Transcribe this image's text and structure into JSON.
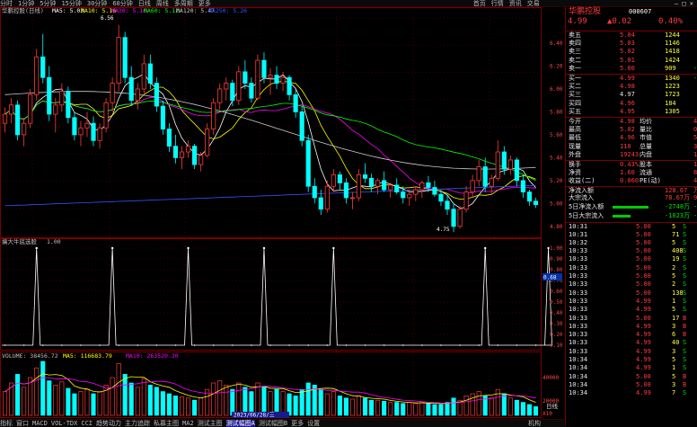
{
  "topbar": {
    "tabs": [
      "分时",
      "1分钟",
      "5分钟",
      "15分钟",
      "30分钟",
      "60分钟",
      "日线",
      "周线",
      "多周期",
      "更多"
    ],
    "right_tabs": [
      "首页",
      "行情",
      "资讯",
      "交易"
    ],
    "win_controls": "— □ ✕"
  },
  "stock": {
    "name": "华鹏控股",
    "code": "000607",
    "price": "4.99",
    "change": "▲0.02",
    "pct": "0.40%"
  },
  "main_legend": {
    "title": "华鹏控股(日线)",
    "ma5": "MA5: 5.03",
    "ma10": "MA10: 5.16",
    "ma20": "MA20: 5.16",
    "ma60": "MA60: 5.12",
    "ma120": "MA120: 5.47",
    "ma250": "MA250: 5.26"
  },
  "price_annotations": {
    "high": "6.56",
    "low": "4.75"
  },
  "colors": {
    "up": "#ff3b3b",
    "down": "#00ffff",
    "ma5": "#ffffff",
    "ma10": "#ffff00",
    "ma20": "#ff00ff",
    "ma60": "#00ff00",
    "ma120": "#cccccc",
    "ma250": "#3355ff"
  },
  "indicator": {
    "title": "擒大牛底选股",
    "value": "1.00",
    "current_marker": "0.68"
  },
  "volume": {
    "title": "VOLUME: 38456.72",
    "ma5": "MA5: 116683.79",
    "ma10": "MA10: 263520.20"
  },
  "date_label": "2023/06/28/三",
  "sell_book": [
    {
      "label": "卖五",
      "price": "5.04",
      "vol": "1244"
    },
    {
      "label": "卖四",
      "price": "5.03",
      "vol": "1146"
    },
    {
      "label": "卖三",
      "price": "5.02",
      "vol": "1418"
    },
    {
      "label": "卖二",
      "price": "5.01",
      "vol": "1424"
    },
    {
      "label": "卖一",
      "price": "5.00",
      "vol": "909",
      "extra": "-5"
    }
  ],
  "buy_book": [
    {
      "label": "买一",
      "price": "4.99",
      "vol": "1340",
      "extra": "-10"
    },
    {
      "label": "买二",
      "price": "4.98",
      "vol": "1223"
    },
    {
      "label": "买三",
      "price": "4.97",
      "vol": "1723"
    },
    {
      "label": "买四",
      "price": "4.96",
      "vol": "184"
    },
    {
      "label": "买五",
      "price": "4.95",
      "vol": "1305"
    }
  ],
  "stats": [
    {
      "l1": "今开",
      "v1": "4.98",
      "l2": "均价",
      "v2": "4.9"
    },
    {
      "l1": "最高",
      "v1": "5.02",
      "l2": "量比",
      "v2": "0.7"
    },
    {
      "l1": "最低",
      "v1": "4.96",
      "l2": "市值",
      "v2": "50.8"
    },
    {
      "l1": "现量",
      "v1": "110",
      "l2": "总量",
      "v2": "3845"
    },
    {
      "l1": "外盘",
      "v1": "19243",
      "l2": "内盘",
      "v2": "1921"
    },
    {
      "l1": "换手",
      "v1": "0.43%",
      "l2": "股本",
      "v2": "10.2"
    },
    {
      "l1": "净资",
      "v1": "1.60",
      "l2": "流通",
      "v2": "8.85"
    },
    {
      "l1": "收益(二)",
      "v1": "0.060",
      "l2": "PE(动)",
      "v2": "45."
    }
  ],
  "flows": [
    {
      "label": "净流入额",
      "value": "128.67",
      "extra": "万"
    },
    {
      "label": "大宗流入",
      "value": "78.67万",
      "extra": "95"
    },
    {
      "label": "5日净流入额",
      "value": "-2748万",
      "extra": "-5"
    },
    {
      "label": "5日大宗流入",
      "value": "-1023万",
      "extra": "-35"
    }
  ],
  "ticks": [
    {
      "t": "10:31",
      "p": "5.00",
      "v": "5",
      "d": "S"
    },
    {
      "t": "10:31",
      "p": "5.00",
      "v": "71",
      "d": "S"
    },
    {
      "t": "10:32",
      "p": "5.00",
      "v": "5",
      "d": "S"
    },
    {
      "t": "10:33",
      "p": "5.00",
      "v": "408",
      "d": "S"
    },
    {
      "t": "10:33",
      "p": "5.00",
      "v": "19",
      "d": "S"
    },
    {
      "t": "10:33",
      "p": "5.00",
      "v": "2",
      "d": "S"
    },
    {
      "t": "10:33",
      "p": "5.00",
      "v": "5",
      "d": "S"
    },
    {
      "t": "10:33",
      "p": "5.00",
      "v": "2",
      "d": "S"
    },
    {
      "t": "10:33",
      "p": "5.00",
      "v": "138",
      "d": "S"
    },
    {
      "t": "10:33",
      "p": "4.99",
      "v": "1",
      "d": "S"
    },
    {
      "t": "10:33",
      "p": "4.99",
      "v": "5",
      "d": "S"
    },
    {
      "t": "10:33",
      "p": "5.00",
      "v": "17",
      "d": "B"
    },
    {
      "t": "10:33",
      "p": "4.99",
      "v": "3",
      "d": "B"
    },
    {
      "t": "10:33",
      "p": "4.99",
      "v": "6",
      "d": "B"
    },
    {
      "t": "10:33",
      "p": "4.99",
      "v": "40",
      "d": "S"
    },
    {
      "t": "10:33",
      "p": "4.99",
      "v": "3",
      "d": "S"
    },
    {
      "t": "10:34",
      "p": "4.99",
      "v": "5",
      "d": "S"
    },
    {
      "t": "10:34",
      "p": "4.99",
      "v": "1",
      "d": "S"
    },
    {
      "t": "10:34",
      "p": "5.00",
      "v": "5",
      "d": "B"
    },
    {
      "t": "10:34",
      "p": "5.00",
      "v": "3",
      "d": "B"
    },
    {
      "t": "10:34",
      "p": "4.99",
      "v": "7",
      "d": "S"
    }
  ],
  "panel_tabs": [
    "日线",
    "..."
  ],
  "bottom_tabs": [
    "指标",
    "窗口",
    "MACD",
    "VOL-TDX",
    "CCI",
    "趋势动力",
    "主力追踪",
    "私募主图",
    "MA2",
    "测试主图",
    "测试幅图A",
    "测试幅图B",
    "更多",
    "设置"
  ],
  "bottom_right": "机构",
  "chart_data": {
    "type": "candlestick",
    "price_axis": [
      "6.40",
      "6.20",
      "6.00",
      "5.80",
      "5.60",
      "5.40",
      "5.20",
      "5.00",
      "4.80"
    ],
    "ylim": [
      4.72,
      6.62
    ],
    "indicator_axis": [
      "1.00",
      "0.90",
      "0.80",
      "0.70",
      "0.60",
      "0.50",
      "0.40",
      "0.30",
      "0.20",
      "0.10"
    ],
    "volume_axis": [
      "40000",
      "20000",
      "X10"
    ],
    "candles": [
      [
        5.7,
        5.84,
        5.62,
        5.78
      ],
      [
        5.78,
        5.92,
        5.7,
        5.86
      ],
      [
        5.86,
        5.9,
        5.55,
        5.6
      ],
      [
        5.6,
        5.75,
        5.5,
        5.7
      ],
      [
        5.7,
        6.0,
        5.66,
        5.95
      ],
      [
        5.95,
        6.35,
        5.9,
        6.28
      ],
      [
        6.28,
        6.48,
        6.05,
        6.1
      ],
      [
        6.1,
        6.2,
        5.72,
        5.78
      ],
      [
        5.78,
        5.92,
        5.62,
        5.86
      ],
      [
        5.86,
        6.05,
        5.8,
        5.98
      ],
      [
        5.98,
        6.02,
        5.7,
        5.75
      ],
      [
        5.75,
        5.8,
        5.55,
        5.6
      ],
      [
        5.6,
        5.72,
        5.5,
        5.66
      ],
      [
        5.66,
        5.8,
        5.58,
        5.7
      ],
      [
        5.7,
        5.76,
        5.5,
        5.55
      ],
      [
        5.55,
        5.7,
        5.48,
        5.66
      ],
      [
        5.66,
        5.92,
        5.62,
        5.88
      ],
      [
        5.88,
        6.1,
        5.8,
        6.05
      ],
      [
        6.05,
        6.56,
        5.98,
        6.45
      ],
      [
        6.45,
        6.5,
        6.05,
        6.1
      ],
      [
        6.1,
        6.2,
        5.85,
        5.9
      ],
      [
        5.9,
        6.05,
        5.82,
        6.0
      ],
      [
        6.0,
        6.3,
        5.95,
        6.22
      ],
      [
        6.22,
        6.3,
        6.0,
        6.05
      ],
      [
        6.05,
        6.1,
        5.8,
        5.85
      ],
      [
        5.85,
        5.9,
        5.6,
        5.65
      ],
      [
        5.65,
        5.7,
        5.45,
        5.5
      ],
      [
        5.5,
        5.6,
        5.35,
        5.4
      ],
      [
        5.4,
        5.5,
        5.3,
        5.45
      ],
      [
        5.45,
        5.55,
        5.4,
        5.5
      ],
      [
        5.5,
        5.52,
        5.3,
        5.34
      ],
      [
        5.34,
        5.45,
        5.28,
        5.42
      ],
      [
        5.42,
        5.7,
        5.4,
        5.65
      ],
      [
        5.65,
        5.92,
        5.6,
        5.88
      ],
      [
        5.88,
        6.05,
        5.82,
        6.0
      ],
      [
        6.0,
        6.1,
        5.9,
        6.05
      ],
      [
        6.05,
        6.08,
        5.85,
        5.9
      ],
      [
        5.9,
        6.2,
        5.86,
        6.15
      ],
      [
        6.15,
        6.25,
        6.0,
        6.05
      ],
      [
        6.05,
        6.1,
        5.88,
        5.92
      ],
      [
        5.92,
        6.3,
        5.9,
        6.25
      ],
      [
        6.25,
        6.32,
        6.05,
        6.1
      ],
      [
        6.1,
        6.18,
        5.95,
        6.12
      ],
      [
        6.12,
        6.2,
        6.0,
        6.05
      ],
      [
        6.05,
        6.15,
        5.98,
        6.1
      ],
      [
        6.1,
        6.12,
        5.9,
        5.95
      ],
      [
        5.95,
        6.0,
        5.75,
        5.8
      ],
      [
        5.8,
        5.85,
        5.5,
        5.55
      ],
      [
        5.55,
        5.6,
        5.1,
        5.15
      ],
      [
        5.15,
        5.22,
        5.0,
        5.05
      ],
      [
        5.05,
        5.12,
        4.9,
        4.95
      ],
      [
        4.95,
        5.2,
        4.92,
        5.15
      ],
      [
        5.15,
        5.3,
        5.1,
        5.25
      ],
      [
        5.25,
        5.28,
        5.12,
        5.18
      ],
      [
        5.18,
        5.22,
        5.0,
        5.05
      ],
      [
        5.05,
        5.1,
        4.95,
        5.05
      ],
      [
        5.05,
        5.3,
        5.02,
        5.25
      ],
      [
        5.25,
        5.35,
        5.18,
        5.22
      ],
      [
        5.22,
        5.26,
        5.1,
        5.15
      ],
      [
        5.15,
        5.22,
        5.08,
        5.2
      ],
      [
        5.2,
        5.28,
        5.1,
        5.12
      ],
      [
        5.12,
        5.18,
        5.05,
        5.16
      ],
      [
        5.16,
        5.22,
        5.08,
        5.1
      ],
      [
        5.1,
        5.15,
        5.0,
        5.05
      ],
      [
        5.05,
        5.12,
        4.98,
        5.08
      ],
      [
        5.08,
        5.15,
        5.02,
        5.12
      ],
      [
        5.12,
        5.2,
        5.05,
        5.18
      ],
      [
        5.18,
        5.24,
        5.1,
        5.14
      ],
      [
        5.14,
        5.2,
        5.06,
        5.08
      ],
      [
        5.08,
        5.12,
        4.98,
        5.02
      ],
      [
        5.02,
        5.08,
        4.9,
        4.95
      ],
      [
        4.95,
        5.0,
        4.75,
        4.8
      ],
      [
        4.8,
        4.98,
        4.78,
        4.95
      ],
      [
        4.95,
        5.15,
        4.92,
        5.1
      ],
      [
        5.1,
        5.25,
        5.05,
        5.2
      ],
      [
        5.2,
        5.38,
        5.15,
        5.32
      ],
      [
        5.32,
        5.4,
        5.1,
        5.15
      ],
      [
        5.15,
        5.25,
        5.08,
        5.22
      ],
      [
        5.22,
        5.55,
        5.2,
        5.45
      ],
      [
        5.45,
        5.5,
        5.25,
        5.3
      ],
      [
        5.3,
        5.42,
        5.25,
        5.38
      ],
      [
        5.38,
        5.4,
        5.15,
        5.2
      ],
      [
        5.2,
        5.25,
        5.05,
        5.1
      ],
      [
        5.1,
        5.12,
        4.98,
        5.02
      ],
      [
        5.02,
        5.05,
        4.96,
        4.99
      ]
    ],
    "ma_legend_colors": [
      "ma5",
      "ma10",
      "ma20",
      "ma60",
      "ma120",
      "ma250"
    ],
    "signal_spikes": [
      5,
      17,
      29,
      41,
      52,
      76,
      86
    ],
    "volumes": [
      22,
      30,
      38,
      26,
      35,
      44,
      50,
      32,
      28,
      31,
      25,
      20,
      22,
      24,
      20,
      22,
      28,
      35,
      48,
      38,
      30,
      26,
      34,
      28,
      26,
      22,
      20,
      18,
      17,
      16,
      14,
      16,
      24,
      30,
      32,
      28,
      24,
      30,
      26,
      22,
      30,
      26,
      22,
      24,
      22,
      20,
      18,
      24,
      30,
      28,
      24,
      20,
      22,
      18,
      16,
      15,
      18,
      16,
      14,
      14,
      13,
      12,
      12,
      11,
      12,
      11,
      12,
      11,
      10,
      10,
      12,
      16,
      14,
      18,
      20,
      22,
      18,
      16,
      24,
      20,
      16,
      14,
      12,
      10,
      8
    ]
  }
}
